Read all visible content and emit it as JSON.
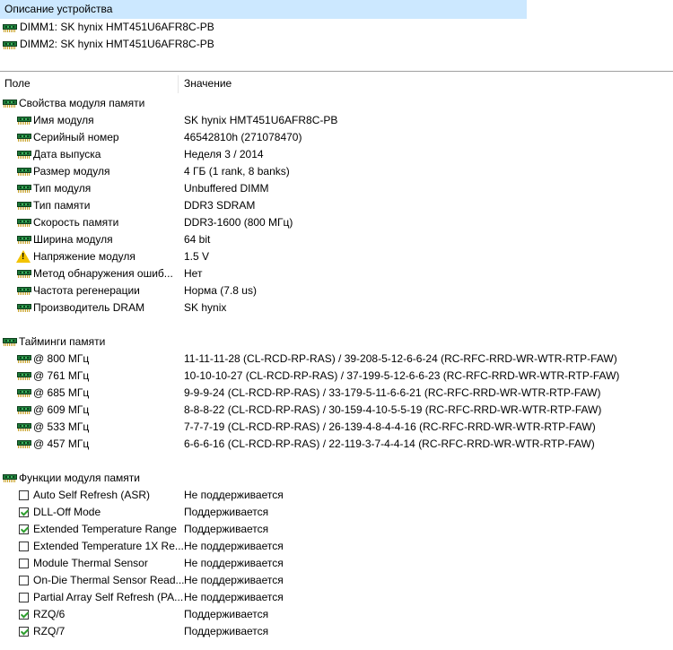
{
  "device_panel": {
    "header": "Описание устройства",
    "devices": [
      {
        "label": "DIMM1: SK hynix HMT451U6AFR8C-PB",
        "icon": "ram-module-icon"
      },
      {
        "label": "DIMM2: SK hynix HMT451U6AFR8C-PB",
        "icon": "ram-module-icon"
      }
    ]
  },
  "columns": {
    "field": "Поле",
    "value": "Значение"
  },
  "sections": [
    {
      "title": "Свойства модуля памяти",
      "rows": [
        {
          "icon": "ram-module-icon",
          "field": "Имя модуля",
          "value": "SK hynix HMT451U6AFR8C-PB"
        },
        {
          "icon": "ram-module-icon",
          "field": "Серийный номер",
          "value": "46542810h (271078470)"
        },
        {
          "icon": "ram-module-icon",
          "field": "Дата выпуска",
          "value": "Неделя 3 / 2014"
        },
        {
          "icon": "ram-module-icon",
          "field": "Размер модуля",
          "value": "4 ГБ (1 rank, 8 banks)"
        },
        {
          "icon": "ram-module-icon",
          "field": "Тип модуля",
          "value": "Unbuffered DIMM"
        },
        {
          "icon": "ram-module-icon",
          "field": "Тип памяти",
          "value": "DDR3 SDRAM"
        },
        {
          "icon": "ram-module-icon",
          "field": "Скорость памяти",
          "value": "DDR3-1600 (800 МГц)"
        },
        {
          "icon": "ram-module-icon",
          "field": "Ширина модуля",
          "value": "64 bit"
        },
        {
          "icon": "warning-icon",
          "field": "Напряжение модуля",
          "value": "1.5 V"
        },
        {
          "icon": "ram-module-icon",
          "field": "Метод обнаружения ошиб...",
          "value": "Нет"
        },
        {
          "icon": "ram-module-icon",
          "field": "Частота регенерации",
          "value": "Норма (7.8 us)"
        },
        {
          "icon": "ram-module-icon",
          "field": "Производитель DRAM",
          "value": "SK hynix"
        }
      ]
    },
    {
      "title": "Тайминги памяти",
      "rows": [
        {
          "icon": "ram-module-icon",
          "field": "@ 800 МГц",
          "value": "11-11-11-28  (CL-RCD-RP-RAS) / 39-208-5-12-6-6-24  (RC-RFC-RRD-WR-WTR-RTP-FAW)"
        },
        {
          "icon": "ram-module-icon",
          "field": "@ 761 МГц",
          "value": "10-10-10-27  (CL-RCD-RP-RAS) / 37-199-5-12-6-6-23  (RC-RFC-RRD-WR-WTR-RTP-FAW)"
        },
        {
          "icon": "ram-module-icon",
          "field": "@ 685 МГц",
          "value": "9-9-9-24  (CL-RCD-RP-RAS) / 33-179-5-11-6-6-21  (RC-RFC-RRD-WR-WTR-RTP-FAW)"
        },
        {
          "icon": "ram-module-icon",
          "field": "@ 609 МГц",
          "value": "8-8-8-22  (CL-RCD-RP-RAS) / 30-159-4-10-5-5-19  (RC-RFC-RRD-WR-WTR-RTP-FAW)"
        },
        {
          "icon": "ram-module-icon",
          "field": "@ 533 МГц",
          "value": "7-7-7-19  (CL-RCD-RP-RAS) / 26-139-4-8-4-4-16  (RC-RFC-RRD-WR-WTR-RTP-FAW)"
        },
        {
          "icon": "ram-module-icon",
          "field": "@ 457 МГц",
          "value": "6-6-6-16  (CL-RCD-RP-RAS) / 22-119-3-7-4-4-14  (RC-RFC-RRD-WR-WTR-RTP-FAW)"
        }
      ]
    },
    {
      "title": "Функции модуля памяти",
      "rows": [
        {
          "checked": false,
          "field": "Auto Self Refresh (ASR)",
          "value": "Не поддерживается"
        },
        {
          "checked": true,
          "field": "DLL-Off Mode",
          "value": "Поддерживается"
        },
        {
          "checked": true,
          "field": "Extended Temperature Range",
          "value": "Поддерживается"
        },
        {
          "checked": false,
          "field": "Extended Temperature 1X Re...",
          "value": "Не поддерживается"
        },
        {
          "checked": false,
          "field": "Module Thermal Sensor",
          "value": "Не поддерживается"
        },
        {
          "checked": false,
          "field": "On-Die Thermal Sensor Read...",
          "value": "Не поддерживается"
        },
        {
          "checked": false,
          "field": "Partial Array Self Refresh (PA...",
          "value": "Не поддерживается"
        },
        {
          "checked": true,
          "field": "RZQ/6",
          "value": "Поддерживается"
        },
        {
          "checked": true,
          "field": "RZQ/7",
          "value": "Поддерживается"
        }
      ]
    }
  ]
}
